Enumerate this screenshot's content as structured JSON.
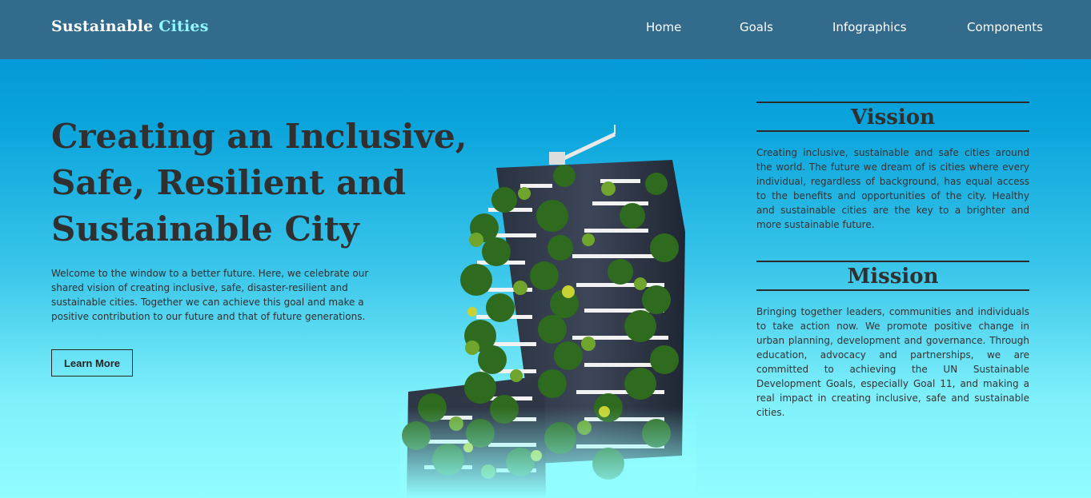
{
  "header": {
    "brand_main": "Sustainable",
    "brand_accent": "Cities",
    "nav": [
      "Home",
      "Goals",
      "Infographics",
      "Components"
    ]
  },
  "hero": {
    "title": "Creating an Inclusive, Safe, Resilient and Sustainable City",
    "text": "Welcome to the window to a better future. Here, we celebrate our shared vision of creating inclusive, safe, disaster-resilient and sustainable cities. Together we can achieve this goal and make a positive contribution to our future and that of future generations.",
    "button_label": "Learn More"
  },
  "vision": {
    "title": "Vission",
    "text": "Creating inclusive, sustainable and safe cities around the world. The future we dream of is cities where every individual, regardless of background, has equal access to the benefits and opportunities of the city. Healthy and sustainable cities are the key to a brighter and more sustainable future."
  },
  "mission": {
    "title": "Mission",
    "text": "Bringing together leaders, communities and individuals to take action now. We promote positive change in urban planning, development and governance. Through education, advocacy and partnerships, we are committed to achieving the UN Sustainable Development Goals, especially Goal 11, and making a real impact in creating inclusive, safe and sustainable cities."
  },
  "colors": {
    "navbar": "#336b8c",
    "brand_accent": "#8ef7ff",
    "gradient_top": "#0090d3",
    "gradient_bottom": "#92fdff",
    "text_dark": "#303030"
  },
  "icons": {
    "hero_image": "green-tower-building-image"
  }
}
